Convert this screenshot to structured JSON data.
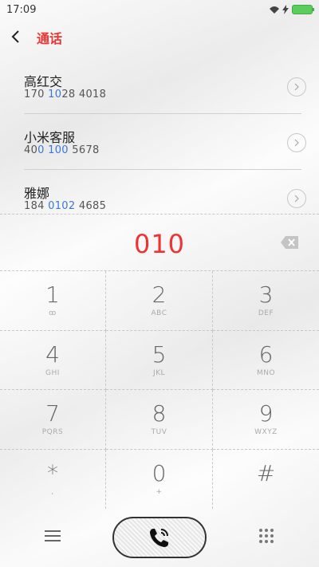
{
  "status_bar": {
    "time": "17:09",
    "signal_icon": "signal-icon",
    "charging_icon": "bolt-icon",
    "battery_icon": "battery-icon"
  },
  "header": {
    "title": "通话",
    "back_icon": "chevron-left-icon"
  },
  "contacts": [
    {
      "name": "高红交",
      "number_parts": [
        "170 ",
        "10",
        "28 4018"
      ]
    },
    {
      "name": "小米客服",
      "number_parts": [
        "40",
        "0 100",
        " 5678"
      ]
    },
    {
      "name": "雅娜",
      "number_parts": [
        "184 ",
        "0102",
        " 4685"
      ]
    }
  ],
  "dialer": {
    "input": "010"
  },
  "keypad": [
    {
      "digit": "1",
      "letters": "ꝏ"
    },
    {
      "digit": "2",
      "letters": "ABC"
    },
    {
      "digit": "3",
      "letters": "DEF"
    },
    {
      "digit": "4",
      "letters": "GHI"
    },
    {
      "digit": "5",
      "letters": "JKL"
    },
    {
      "digit": "6",
      "letters": "MNO"
    },
    {
      "digit": "7",
      "letters": "PQRS"
    },
    {
      "digit": "8",
      "letters": "TUV"
    },
    {
      "digit": "9",
      "letters": "WXYZ"
    },
    {
      "digit": "*",
      "letters": ","
    },
    {
      "digit": "0",
      "letters": "+"
    },
    {
      "digit": "#",
      "letters": ""
    }
  ],
  "colors": {
    "accent": "#e33333",
    "match": "#3a78d8",
    "battery": "#5ccc5c"
  }
}
